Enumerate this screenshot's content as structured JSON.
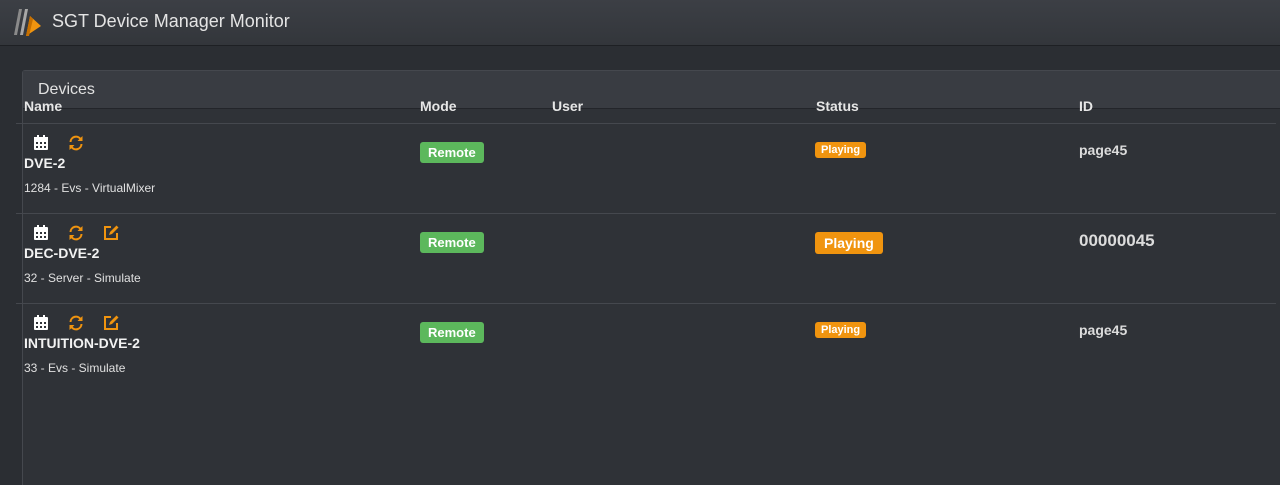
{
  "app": {
    "title": "SGT Device Manager Monitor",
    "logo_icon": "sgt-logo-icon"
  },
  "panel": {
    "title": "Devices"
  },
  "columns": {
    "name": "Name",
    "mode": "Mode",
    "user": "User",
    "status": "Status",
    "id": "ID"
  },
  "colors": {
    "accent_orange": "#f0940f",
    "remote_green": "#5cb85c"
  },
  "devices": [
    {
      "icons": [
        "calendar-icon",
        "refresh-icon"
      ],
      "name": "DVE-2",
      "subtitle": "1284 - Evs - VirtualMixer",
      "mode": "Remote",
      "user": "",
      "status": "Playing",
      "id": "page45"
    },
    {
      "icons": [
        "calendar-icon",
        "refresh-icon",
        "edit-icon"
      ],
      "name": "DEC-DVE-2",
      "subtitle": "32 - Server - Simulate",
      "mode": "Remote",
      "user": "",
      "status": "Playing",
      "id": "00000045"
    },
    {
      "icons": [
        "calendar-icon",
        "refresh-icon",
        "edit-icon"
      ],
      "name": "INTUITION-DVE-2",
      "subtitle": "33 - Evs - Simulate",
      "mode": "Remote",
      "user": "",
      "status": "Playing",
      "id": "page45"
    }
  ]
}
